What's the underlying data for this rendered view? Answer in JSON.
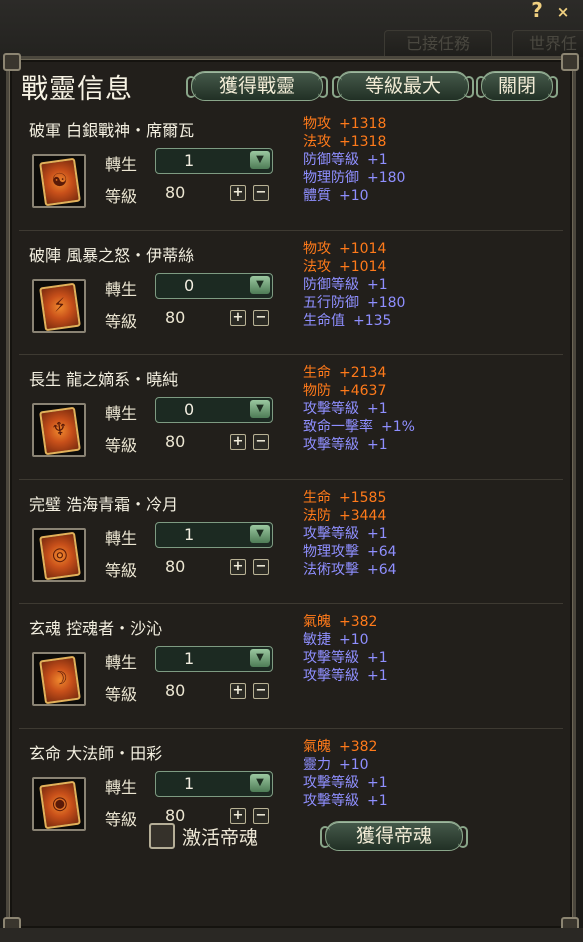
{
  "window": {
    "help_label": "?",
    "close_label": "×",
    "tabs": [
      "已接任務",
      "世界任"
    ]
  },
  "panel": {
    "title": "戰靈信息",
    "buttons": {
      "obtain": "獲得戰靈",
      "max_level": "等級最大",
      "close": "關閉"
    },
    "labels": {
      "rebirth": "轉生",
      "level": "等級"
    }
  },
  "spirits": [
    {
      "name": "破軍 白銀戰神・席爾瓦",
      "rebirth": "1",
      "level": "80",
      "stats": [
        {
          "label": "物攻",
          "value": "+1318",
          "color": "#ff7a1a"
        },
        {
          "label": "法攻",
          "value": "+1318",
          "color": "#ff7a1a"
        },
        {
          "label": "防御等級",
          "value": "+1",
          "color": "#8f8fff"
        },
        {
          "label": "物理防御",
          "value": "+180",
          "color": "#8f8fff"
        },
        {
          "label": "體質",
          "value": "+10",
          "color": "#8f8fff"
        }
      ]
    },
    {
      "name": "破陣 風暴之怒・伊蒂絲",
      "rebirth": "0",
      "level": "80",
      "stats": [
        {
          "label": "物攻",
          "value": "+1014",
          "color": "#ff7a1a"
        },
        {
          "label": "法攻",
          "value": "+1014",
          "color": "#ff7a1a"
        },
        {
          "label": "防御等級",
          "value": "+1",
          "color": "#8f8fff"
        },
        {
          "label": "五行防御",
          "value": "+180",
          "color": "#8f8fff"
        },
        {
          "label": "生命值",
          "value": "+135",
          "color": "#8f8fff"
        }
      ]
    },
    {
      "name": "長生 龍之嫡系・曉純",
      "rebirth": "0",
      "level": "80",
      "stats": [
        {
          "label": "生命",
          "value": "+2134",
          "color": "#ff7a1a"
        },
        {
          "label": "物防",
          "value": "+4637",
          "color": "#ff7a1a"
        },
        {
          "label": "攻擊等級",
          "value": "+1",
          "color": "#8f8fff"
        },
        {
          "label": "致命一擊率",
          "value": "+1%",
          "color": "#8f8fff"
        },
        {
          "label": "攻擊等級",
          "value": "+1",
          "color": "#8f8fff"
        }
      ]
    },
    {
      "name": "完璧 浩海青霜・冷月",
      "rebirth": "1",
      "level": "80",
      "stats": [
        {
          "label": "生命",
          "value": "+1585",
          "color": "#ff7a1a"
        },
        {
          "label": "法防",
          "value": "+3444",
          "color": "#ff7a1a"
        },
        {
          "label": "攻擊等級",
          "value": "+1",
          "color": "#8f8fff"
        },
        {
          "label": "物理攻擊",
          "value": "+64",
          "color": "#8f8fff"
        },
        {
          "label": "法術攻擊",
          "value": "+64",
          "color": "#8f8fff"
        }
      ]
    },
    {
      "name": "玄魂 控魂者・沙沁",
      "rebirth": "1",
      "level": "80",
      "stats": [
        {
          "label": "氣魄",
          "value": "+382",
          "color": "#ff7a1a"
        },
        {
          "label": "敏捷",
          "value": "+10",
          "color": "#8f8fff"
        },
        {
          "label": "攻擊等級",
          "value": "+1",
          "color": "#8f8fff"
        },
        {
          "label": "攻擊等級",
          "value": "+1",
          "color": "#8f8fff"
        }
      ]
    },
    {
      "name": "玄命 大法師・田彩",
      "rebirth": "1",
      "level": "80",
      "stats": [
        {
          "label": "氣魄",
          "value": "+382",
          "color": "#ff7a1a"
        },
        {
          "label": "靈力",
          "value": "+10",
          "color": "#8f8fff"
        },
        {
          "label": "攻擊等級",
          "value": "+1",
          "color": "#8f8fff"
        },
        {
          "label": "攻擊等級",
          "value": "+1",
          "color": "#8f8fff"
        }
      ]
    }
  ],
  "footer": {
    "activate_label": "激活帝魂",
    "obtain_label": "獲得帝魂"
  }
}
